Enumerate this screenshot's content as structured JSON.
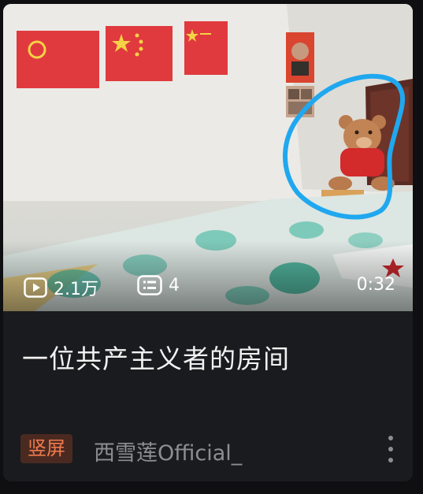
{
  "video": {
    "views": "2.1万",
    "comments": "4",
    "duration": "0:32",
    "title": "一位共产主义者的房间",
    "tag": "竖屏",
    "author": "西雪莲Official_"
  },
  "colors": {
    "card_background": "#1a1b1e",
    "tag_background": "#4a2a20",
    "tag_text": "#f07a4e",
    "annotation_circle": "#1fa8ef",
    "flag_red": "#e03a3e"
  },
  "icons": {
    "views": "play-icon",
    "comments": "comment-list-icon",
    "more": "more-vertical-icon"
  }
}
